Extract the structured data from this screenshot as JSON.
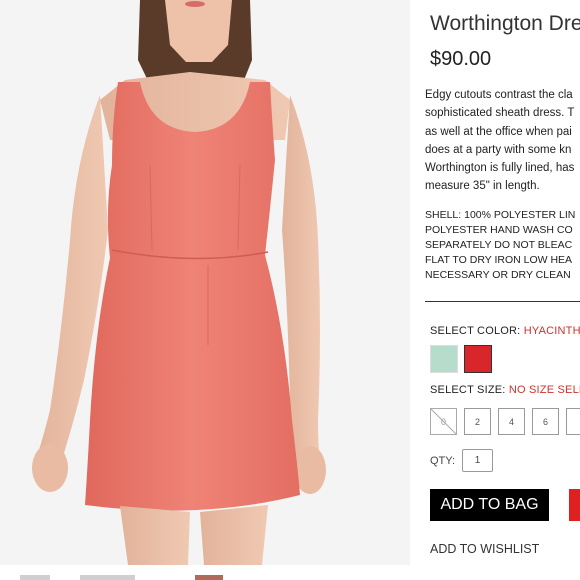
{
  "product": {
    "title": "Worthington Dres",
    "price": "$90.00",
    "description_lines": [
      "Edgy cutouts contrast the cla",
      "sophisticated sheath dress. T",
      "as well at the office when pai",
      "does at a party with some kn",
      "Worthington is fully lined, has",
      "measure 35\" in length."
    ],
    "care_lines": [
      "SHELL: 100% POLYESTER LIN",
      "POLYESTER HAND WASH CO",
      "SEPARATELY DO NOT BLEAC",
      "FLAT TO DRY IRON LOW HEA",
      "NECESSARY OR DRY CLEAN"
    ]
  },
  "color": {
    "label": "SELECT COLOR:",
    "value": "HYACINTH",
    "swatches": [
      {
        "name": "mint",
        "hex": "#b6dccb"
      },
      {
        "name": "red",
        "hex": "#d9262a"
      }
    ]
  },
  "size": {
    "label": "SELECT SIZE:",
    "value": "NO SIZE SELE",
    "options": [
      "0",
      "2",
      "4",
      "6"
    ]
  },
  "qty": {
    "label": "QTY:",
    "value": "1"
  },
  "actions": {
    "add_to_bag": "ADD TO BAG",
    "wishlist": "ADD TO WISHLIST"
  },
  "colors": {
    "dress": "#ec7f72",
    "accent": "#d0312d"
  }
}
